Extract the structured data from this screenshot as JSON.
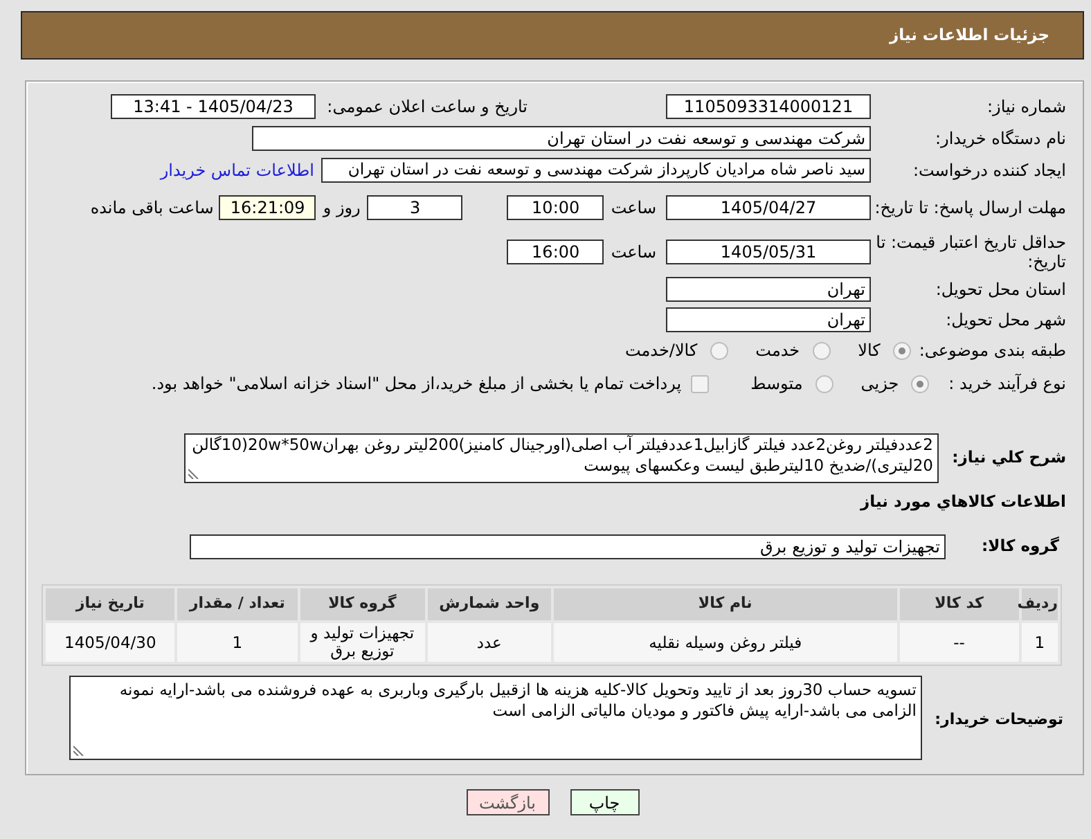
{
  "header": {
    "title": "جزئیات اطلاعات نیاز"
  },
  "need_number": {
    "label": "شماره نیاز:",
    "value": "1105093314000121"
  },
  "announce": {
    "label": "تاریخ و ساعت اعلان عمومی:",
    "value": "1405/04/23 - 13:41"
  },
  "buyer": {
    "label": "نام دستگاه خریدار:",
    "value": "شرکت مهندسی و توسعه نفت در استان تهران"
  },
  "requester": {
    "label": "ایجاد کننده درخواست:",
    "value": "سید ناصر شاه مرادیان کارپرداز شرکت مهندسی و توسعه نفت در استان تهران",
    "link": "اطلاعات تماس خریدار"
  },
  "deadline": {
    "label": "مهلت ارسال پاسخ: تا تاریخ:",
    "date": "1405/04/27",
    "time_label": "ساعت",
    "time": "10:00",
    "days": "3",
    "days_label": "روز و",
    "remaining": "16:21:09",
    "remaining_label": "ساعت باقی مانده"
  },
  "price_validity": {
    "label": "حداقل تاریخ اعتبار قیمت: تا تاریخ:",
    "date": "1405/05/31",
    "time_label": "ساعت",
    "time": "16:00"
  },
  "delivery_province": {
    "label": "استان محل تحویل:",
    "value": "تهران"
  },
  "delivery_city": {
    "label": "شهر محل تحویل:",
    "value": "تهران"
  },
  "category": {
    "label": "طبقه بندی موضوعی:",
    "options": [
      {
        "label": "کالا",
        "selected": true
      },
      {
        "label": "خدمت",
        "selected": false
      },
      {
        "label": "کالا/خدمت",
        "selected": false
      }
    ]
  },
  "process": {
    "label": "نوع فرآیند خرید :",
    "options": [
      {
        "label": "جزیی",
        "selected": true
      },
      {
        "label": "متوسط",
        "selected": false
      }
    ],
    "treasury": {
      "label": "پرداخت تمام یا بخشی از مبلغ خرید،از محل \"اسناد خزانه اسلامی\" خواهد بود.",
      "checked": false
    }
  },
  "description": {
    "label": "شرح کلي نياز:",
    "value": "2عددفیلتر روغن2عدد فیلتر گازابیل1عددفیلتر آب اصلی(اورجینال کامنیز)200لیتر روغن بهران20w*50w(10گالن 20لیتری)/ضدیخ 10لیترطبق لیست وعکسهای پیوست"
  },
  "goods_heading": "اطلاعات کالاهاي مورد نياز",
  "goods_group": {
    "label": "گروه کالا:",
    "value": "تجهیزات تولید و توزیع برق"
  },
  "table": {
    "columns": [
      "ردیف",
      "کد کالا",
      "نام کالا",
      "واحد شمارش",
      "گروه کالا",
      "تعداد / مقدار",
      "تاریخ نیاز"
    ],
    "rows": [
      [
        "1",
        "--",
        "فیلتر روغن وسیله نقلیه",
        "عدد",
        "تجهیزات تولید و توزیع برق",
        "1",
        "1405/04/30"
      ]
    ]
  },
  "buyer_notes": {
    "label": "توضیحات خریدار:",
    "value": "تسویه حساب 30روز بعد از تایید وتحویل کالا-کلیه هزینه ها ازقبیل بارگیری وباربری به عهده فروشنده می باشد-ارایه نمونه الزامی می باشد-ارایه پیش فاکتور و مودیان مالیاتی الزامی است"
  },
  "buttons": [
    {
      "kind": "print",
      "label": "چاپ"
    },
    {
      "kind": "back",
      "label": "بازگشت"
    }
  ]
}
